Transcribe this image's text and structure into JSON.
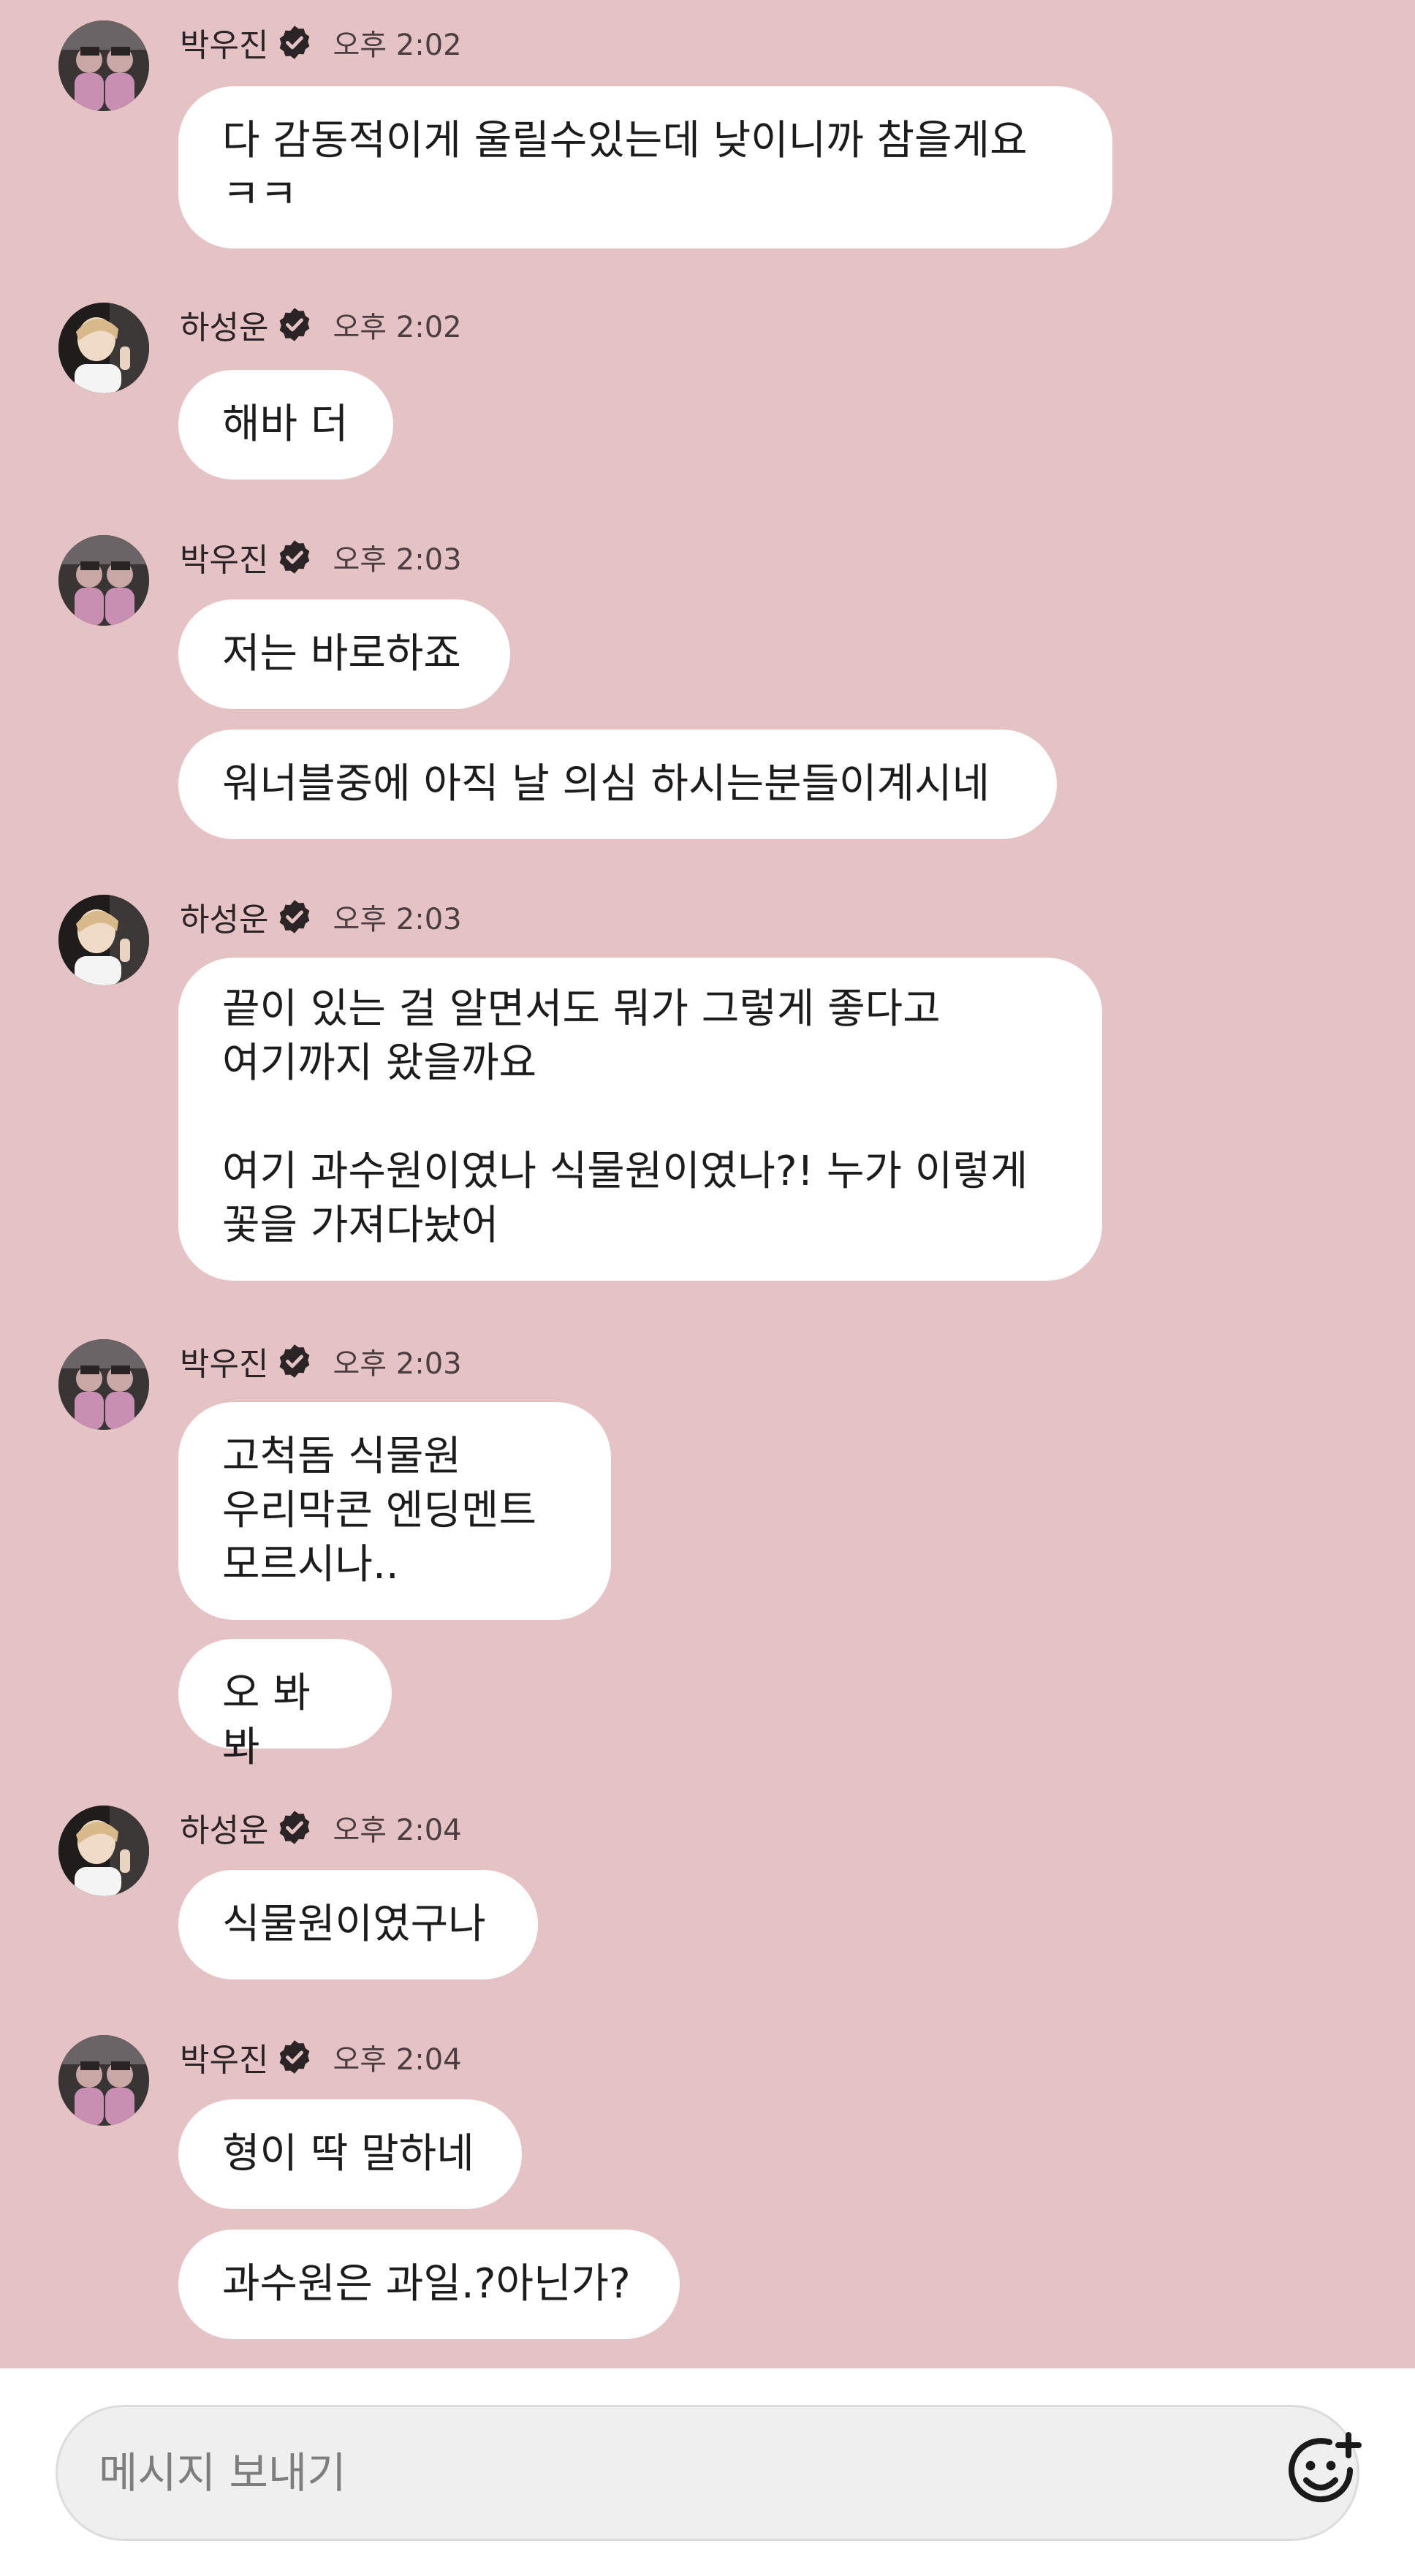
{
  "messages": [
    {
      "sender": "박우진",
      "time": "오후 2:02",
      "avatar": "avatar-woojin",
      "bubbles": [
        "다 감동적이게 울릴수있는데 낮이니까 참을게요\nㅋㅋ"
      ]
    },
    {
      "sender": "하성운",
      "time": "오후 2:02",
      "avatar": "avatar-sungwoon",
      "bubbles": [
        "해바 더"
      ]
    },
    {
      "sender": "박우진",
      "time": "오후 2:03",
      "avatar": "avatar-woojin",
      "bubbles": [
        "저는 바로하죠",
        "워너블중에 아직 날 의심 하시는분들이계시네"
      ]
    },
    {
      "sender": "하성운",
      "time": "오후 2:03",
      "avatar": "avatar-sungwoon",
      "bubbles": [
        "끝이 있는 걸 알면서도 뭐가 그렇게 좋다고\n여기까지 왔을까요\n\n여기 과수원이였나 식물원이였나?! 누가 이렇게\n꽃을 가져다놨어"
      ]
    },
    {
      "sender": "박우진",
      "time": "오후 2:03",
      "avatar": "avatar-woojin",
      "bubbles": [
        "고척돔 식물원\n우리막콘 엔딩멘트\n모르시나..",
        "오 봐봐"
      ]
    },
    {
      "sender": "하성운",
      "time": "오후 2:04",
      "avatar": "avatar-sungwoon",
      "bubbles": [
        "식물원이였구나"
      ]
    },
    {
      "sender": "박우진",
      "time": "오후 2:04",
      "avatar": "avatar-woojin",
      "bubbles": [
        "형이 딱 말하네",
        "과수원은 과일.?아닌가?"
      ]
    }
  ],
  "composer": {
    "placeholder": "메시지 보내기",
    "emoji_icon": "emoji-add-icon"
  },
  "verified_icon": "verified-badge-icon",
  "colors": {
    "background": "#e5c3c4",
    "bubble": "#ffffff",
    "composer": "#efefef"
  }
}
